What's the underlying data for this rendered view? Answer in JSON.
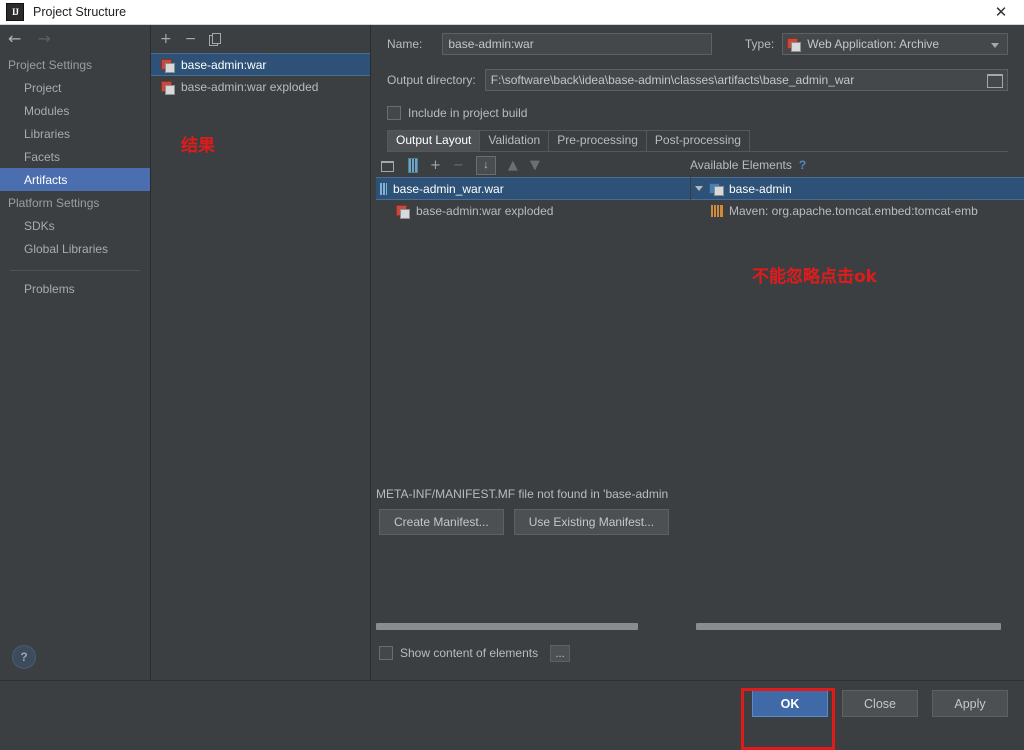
{
  "window": {
    "title": "Project Structure",
    "app_icon": "intellij-idea-icon",
    "close_label": "✕"
  },
  "nav": {
    "back_icon": "←",
    "forward_icon": "→",
    "groups": [
      {
        "label": "Project Settings",
        "items": [
          {
            "label": "Project",
            "selected": false
          },
          {
            "label": "Modules",
            "selected": false
          },
          {
            "label": "Libraries",
            "selected": false
          },
          {
            "label": "Facets",
            "selected": false
          },
          {
            "label": "Artifacts",
            "selected": true
          }
        ]
      },
      {
        "label": "Platform Settings",
        "items": [
          {
            "label": "SDKs",
            "selected": false
          },
          {
            "label": "Global Libraries",
            "selected": false
          }
        ]
      }
    ],
    "problems_label": "Problems",
    "help_label": "?"
  },
  "artifact_list": {
    "toolbar": {
      "add_label": "+",
      "remove_label": "−",
      "copy_label": "copy"
    },
    "items": [
      {
        "label": "base-admin:war",
        "selected": true
      },
      {
        "label": "base-admin:war exploded",
        "selected": false
      }
    ]
  },
  "annotations": {
    "result_note": "结果",
    "ok_note": "不能忽略点击ok",
    "red": "#e01b1b"
  },
  "details": {
    "name_label": "Name:",
    "name_value": "base-admin:war",
    "type_label": "Type:",
    "type_value": "Web Application: Archive",
    "output_label": "Output directory:",
    "output_value": "F:\\software\\back\\idea\\base-admin\\classes\\artifacts\\base_admin_war",
    "include_label": "Include in project build",
    "include_checked": false
  },
  "tabs": [
    {
      "label": "Output Layout",
      "active": true
    },
    {
      "label": "Validation",
      "active": false
    },
    {
      "label": "Pre-processing",
      "active": false
    },
    {
      "label": "Post-processing",
      "active": false
    }
  ],
  "layout_toolbar": {
    "add_folder_icon": "add-folder-icon",
    "add_archive_icon": "add-archive-icon",
    "add_label": "+",
    "remove_label": "−",
    "sort_label": "↓",
    "move_up_label": "▲",
    "move_down_label": "▼",
    "available_elements_label": "Available Elements",
    "available_help_label": "?"
  },
  "output_tree": [
    {
      "label": "base-admin_war.war",
      "selected": true,
      "indent": false
    },
    {
      "label": "base-admin:war exploded",
      "selected": false,
      "indent": true
    }
  ],
  "available_tree": [
    {
      "label": "base-admin",
      "selected": false,
      "expanded": true
    },
    {
      "label": "Maven: org.apache.tomcat.embed:tomcat-emb",
      "selected": false,
      "expanded": false
    }
  ],
  "manifest": {
    "message": "META-INF/MANIFEST.MF file not found in 'base-admin",
    "create_label": "Create Manifest...",
    "use_existing_label": "Use Existing Manifest..."
  },
  "bottom": {
    "show_content_label": "Show content of elements",
    "show_content_checked": false,
    "dots_label": "..."
  },
  "footer": {
    "ok_label": "OK",
    "close_label": "Close",
    "apply_label": "Apply"
  }
}
